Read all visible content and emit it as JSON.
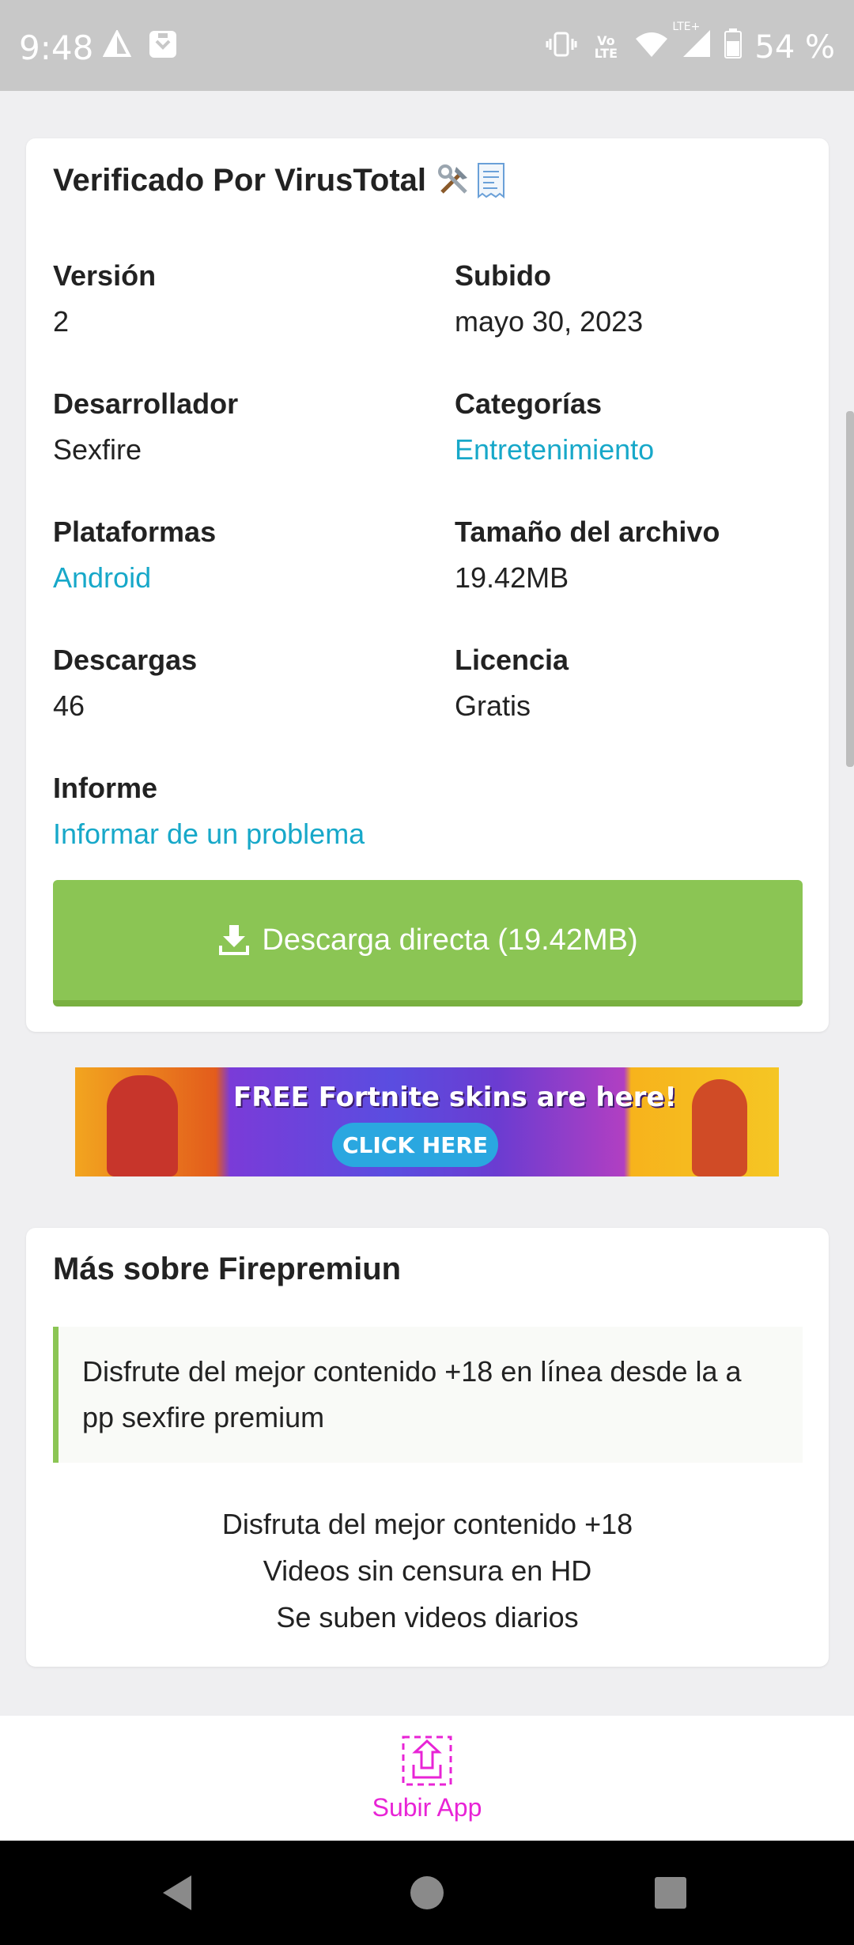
{
  "status_bar": {
    "time": "9:48",
    "lte_label": "Vo LTE",
    "lte_plus": "LTE+",
    "battery": "54 %"
  },
  "info_card": {
    "title": "Verificado Por VirusTotal",
    "title_emojis": [
      "hammer-and-wrench",
      "receipt"
    ],
    "fields": [
      {
        "label": "Versión",
        "value": "2",
        "link": false
      },
      {
        "label": "Subido",
        "value": "mayo 30, 2023",
        "link": false
      },
      {
        "label": "Desarrollador",
        "value": "Sexfire",
        "link": false
      },
      {
        "label": "Categorías",
        "value": "Entretenimiento",
        "link": true
      },
      {
        "label": "Plataformas",
        "value": "Android",
        "link": true
      },
      {
        "label": "Tamaño del archivo",
        "value": "19.42MB",
        "link": false
      },
      {
        "label": "Descargas",
        "value": "46",
        "link": false
      },
      {
        "label": "Licencia",
        "value": "Gratis",
        "link": false
      },
      {
        "label": "Informe",
        "value": "Informar de un problema",
        "link": true
      }
    ],
    "download_button": "Descarga directa (19.42MB)"
  },
  "ad_banner": {
    "headline": "FREE Fortnite skins are here!",
    "cta": "CLICK HERE"
  },
  "more_card": {
    "title": "Más sobre Firepremiun",
    "quote_line1": "Disfrute del mejor contenido +18 en línea desde la a",
    "quote_line2": "pp sexfire premium",
    "lines": [
      "Disfruta del mejor contenido +18",
      "Videos sin censura en HD",
      "Se suben videos diarios"
    ]
  },
  "bottom_bar": {
    "upload_label": "Subir App"
  },
  "colors": {
    "link": "#17a8c9",
    "download_green": "#8bc554",
    "upload_magenta": "#e824d6"
  }
}
